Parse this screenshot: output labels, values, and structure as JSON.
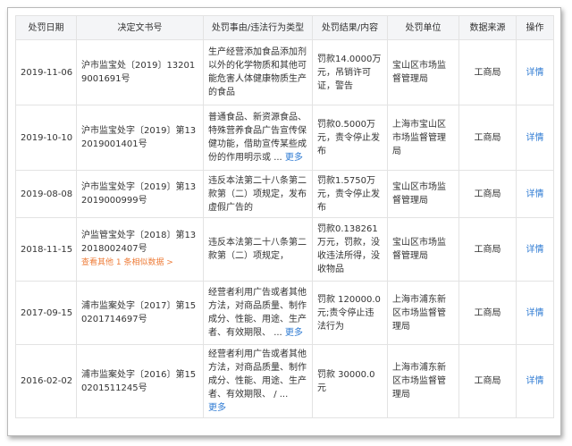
{
  "headers": {
    "date": "处罚日期",
    "doc_no": "决定文书号",
    "reason": "处罚事由/违法行为类型",
    "result": "处罚结果/内容",
    "unit": "处罚单位",
    "source": "数据来源",
    "action": "操作"
  },
  "rows": [
    {
      "date": "2019-11-06",
      "doc_no": "沪市监宝处〔2019〕132019001691号",
      "reason": "生产经营添加食品添加剂以外的化学物质和其他可能危害人体健康物质生产的食品",
      "result": "罚款14.0000万元，吊销许可证，警告",
      "unit": "宝山区市场监督管理局",
      "source": "工商局",
      "action": "详情"
    },
    {
      "date": "2019-10-10",
      "doc_no": "沪市监宝处字〔2019〕第132019001401号",
      "reason": "普通食品、新资源食品、特殊营养食品广告宣传保健功能，借助宣传某些成份的作用明示或",
      "ellipsis": "...",
      "more": "更多",
      "result": "罚款0.5000万元，责令停止发布",
      "unit": "上海市宝山区市场监督管理局",
      "source": "工商局",
      "action": "详情"
    },
    {
      "date": "2019-08-08",
      "doc_no": "沪市监宝处字〔2019〕第132019000999号",
      "reason": "违反本法第二十八条第二款第（二）项规定，发布虚假广告的",
      "result": "罚款1.5750万元，责令停止发布",
      "unit": "宝山区市场监督管理局",
      "source": "工商局",
      "action": "详情"
    },
    {
      "date": "2018-11-15",
      "doc_no": "沪监管宝处字〔2018〕第132018002407号",
      "similar": "查看其他 1 条相似数据 >",
      "reason": "违反本法第二十八条第二款第（二）项规定，",
      "result": "罚款0.138261万元，罚款，没收违法所得，没收物品",
      "unit": "宝山区市场监督管理局",
      "source": "工商局",
      "action": "详情"
    },
    {
      "date": "2017-09-15",
      "doc_no": "浦市监案处字〔2017〕第150201714697号",
      "reason": "经营者利用广告或者其他方法，对商品质量、制作成分、性能、用途、生产者、有效期限、",
      "ellipsis": "...",
      "more": "更多",
      "result": "罚款 120000.0元;责令停止违法行为",
      "unit": "上海市浦东新区市场监督管理局",
      "source": "工商局",
      "action": "详情"
    },
    {
      "date": "2016-02-02",
      "doc_no": "浦市监案处字〔2016〕第150201511245号",
      "reason": "经营者利用广告或者其他方法，对商品质量、制作成分、性能、用途、生产者、有效期限、",
      "ellipsis": "/ ...",
      "more": "更多",
      "result": "罚款 30000.0 元",
      "unit": "上海市浦东新区市场监督管理局",
      "source": "工商局",
      "action": "详情"
    }
  ]
}
